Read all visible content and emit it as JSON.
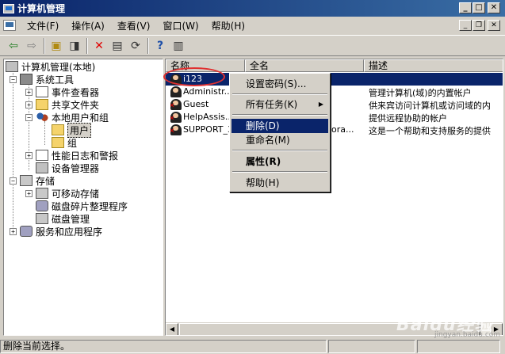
{
  "window": {
    "title": "计算机管理"
  },
  "menu": [
    "文件(F)",
    "操作(A)",
    "查看(V)",
    "窗口(W)",
    "帮助(H)"
  ],
  "tree": {
    "root": "计算机管理(本地)",
    "system_tools": "系统工具",
    "event_viewer": "事件查看器",
    "shared_folders": "共享文件夹",
    "local_users_groups": "本地用户和组",
    "users": "用户",
    "groups": "组",
    "perf_logs": "性能日志和警报",
    "device_manager": "设备管理器",
    "storage": "存储",
    "removable_storage": "可移动存储",
    "defrag": "磁盘碎片整理程序",
    "disk_mgmt": "磁盘管理",
    "services_apps": "服务和应用程序"
  },
  "list": {
    "columns": [
      "名称",
      "全名",
      "描述"
    ],
    "rows": [
      {
        "name": "i123",
        "fullname": "",
        "desc": "",
        "disabled": false
      },
      {
        "name": "Administr...",
        "fullname": "",
        "desc": "管理计算机(域)的内置帐户",
        "disabled": false
      },
      {
        "name": "Guest",
        "fullname": "",
        "desc": "供来宾访问计算机或访问域的内",
        "disabled": true
      },
      {
        "name": "HelpAssis...",
        "fullname": "",
        "desc": "提供远程协助的帐户",
        "disabled": true
      },
      {
        "name": "SUPPORT_3...",
        "fullname": "ora...",
        "desc": "这是一个帮助和支持服务的提供",
        "disabled": true
      }
    ]
  },
  "context_menu": {
    "set_password": "设置密码(S)...",
    "all_tasks": "所有任务(K)",
    "delete": "删除(D)",
    "rename": "重命名(M)",
    "properties": "属性(R)",
    "help": "帮助(H)"
  },
  "status": {
    "text": "删除当前选择。"
  },
  "watermark": {
    "logo": "Baidu经验",
    "url": "jingyan.baidu.com"
  },
  "colors": {
    "title_bar": "#0a246a",
    "selection": "#0a246a",
    "annotation": "#e03030",
    "face": "#d4d0c8"
  }
}
